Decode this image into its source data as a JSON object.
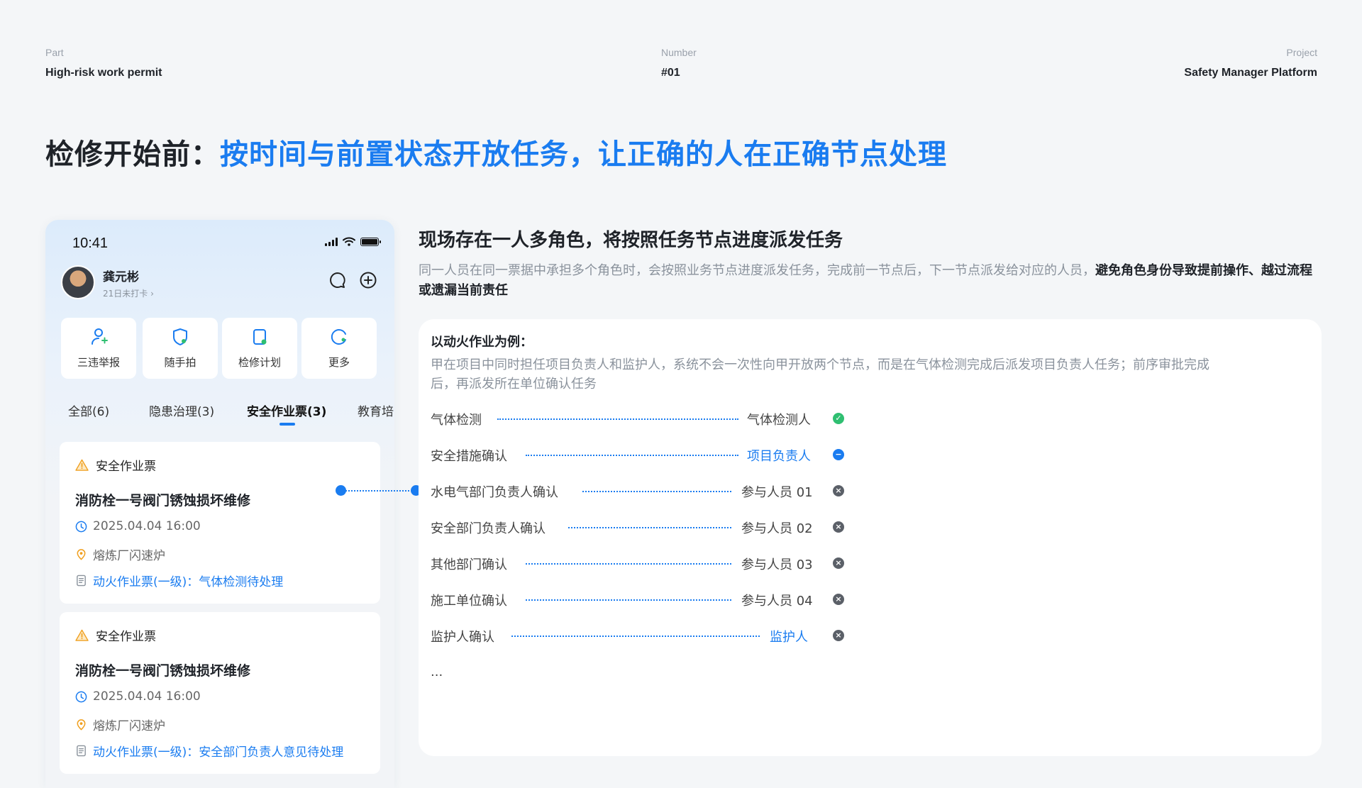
{
  "meta": {
    "part_label": "Part",
    "part_value": "High-risk work permit",
    "number_label": "Number",
    "number_value": "#01",
    "project_label": "Project",
    "project_value": "Safety Manager Platform"
  },
  "headline": {
    "prefix": "检修开始前：",
    "highlight": "按时间与前置状态开放任务，让正确的人在正确节点处理"
  },
  "phone": {
    "time": "10:41",
    "user": {
      "name": "龚元彬",
      "sub": "21日未打卡 ›"
    },
    "quick_actions": [
      {
        "label": "三违举报",
        "icon": "user-report-icon"
      },
      {
        "label": "随手拍",
        "icon": "shield-camera-icon"
      },
      {
        "label": "检修计划",
        "icon": "maintenance-plan-icon"
      },
      {
        "label": "更多",
        "icon": "more-icon"
      }
    ],
    "tabs": [
      "全部(6)",
      "隐患治理(3)",
      "安全作业票(3)",
      "教育培"
    ],
    "active_tab": 2,
    "cards": [
      {
        "type": "安全作业票",
        "title": "消防栓一号阀门锈蚀损坏维修",
        "datetime": "2025.04.04 16:00",
        "location": "熔炼厂闪速炉",
        "status": "动火作业票(一级)：气体检测待处理"
      },
      {
        "type": "安全作业票",
        "title": "消防栓一号阀门锈蚀损坏维修",
        "datetime": "2025.04.04 16:00",
        "location": "熔炼厂闪速炉",
        "status": "动火作业票(一级)：安全部门负责人意见待处理"
      }
    ]
  },
  "right": {
    "title": "现场存在一人多角色，将按照任务节点进度派发任务",
    "desc_normal": "同一人员在同一票据中承担多个角色时，会按照业务节点进度派发任务，完成前一节点后，下一节点派发给对应的人员，",
    "desc_bold": "避免角色身份导致提前操作、越过流程或遗漏当前责任",
    "panel_title": "以动火作业为例：",
    "panel_desc": "甲在项目中同时担任项目负责人和监护人，系统不会一次性向甲开放两个节点，而是在气体检测完成后派发项目负责人任务；前序审批完成后，再派发所在单位确认任务",
    "flow": [
      {
        "step": "气体检测",
        "role": "气体检测人",
        "status": "done",
        "highlight": false
      },
      {
        "step": "安全措施确认",
        "role": "项目负责人",
        "status": "current",
        "highlight": true
      },
      {
        "step": "水电气部门负责人确认",
        "role": "参与人员 01",
        "status": "pending",
        "highlight": false
      },
      {
        "step": "安全部门负责人确认",
        "role": "参与人员 02",
        "status": "pending",
        "highlight": false
      },
      {
        "step": "其他部门确认",
        "role": "参与人员 03",
        "status": "pending",
        "highlight": false
      },
      {
        "step": "施工单位确认",
        "role": "参与人员 04",
        "status": "pending",
        "highlight": false
      },
      {
        "step": "监护人确认",
        "role": "监护人",
        "status": "pending",
        "highlight": true
      }
    ],
    "ellipsis": "..."
  },
  "colors": {
    "accent": "#1a7cf0",
    "done": "#2fbf71",
    "pending": "#5b6068",
    "muted": "#8a929c"
  }
}
